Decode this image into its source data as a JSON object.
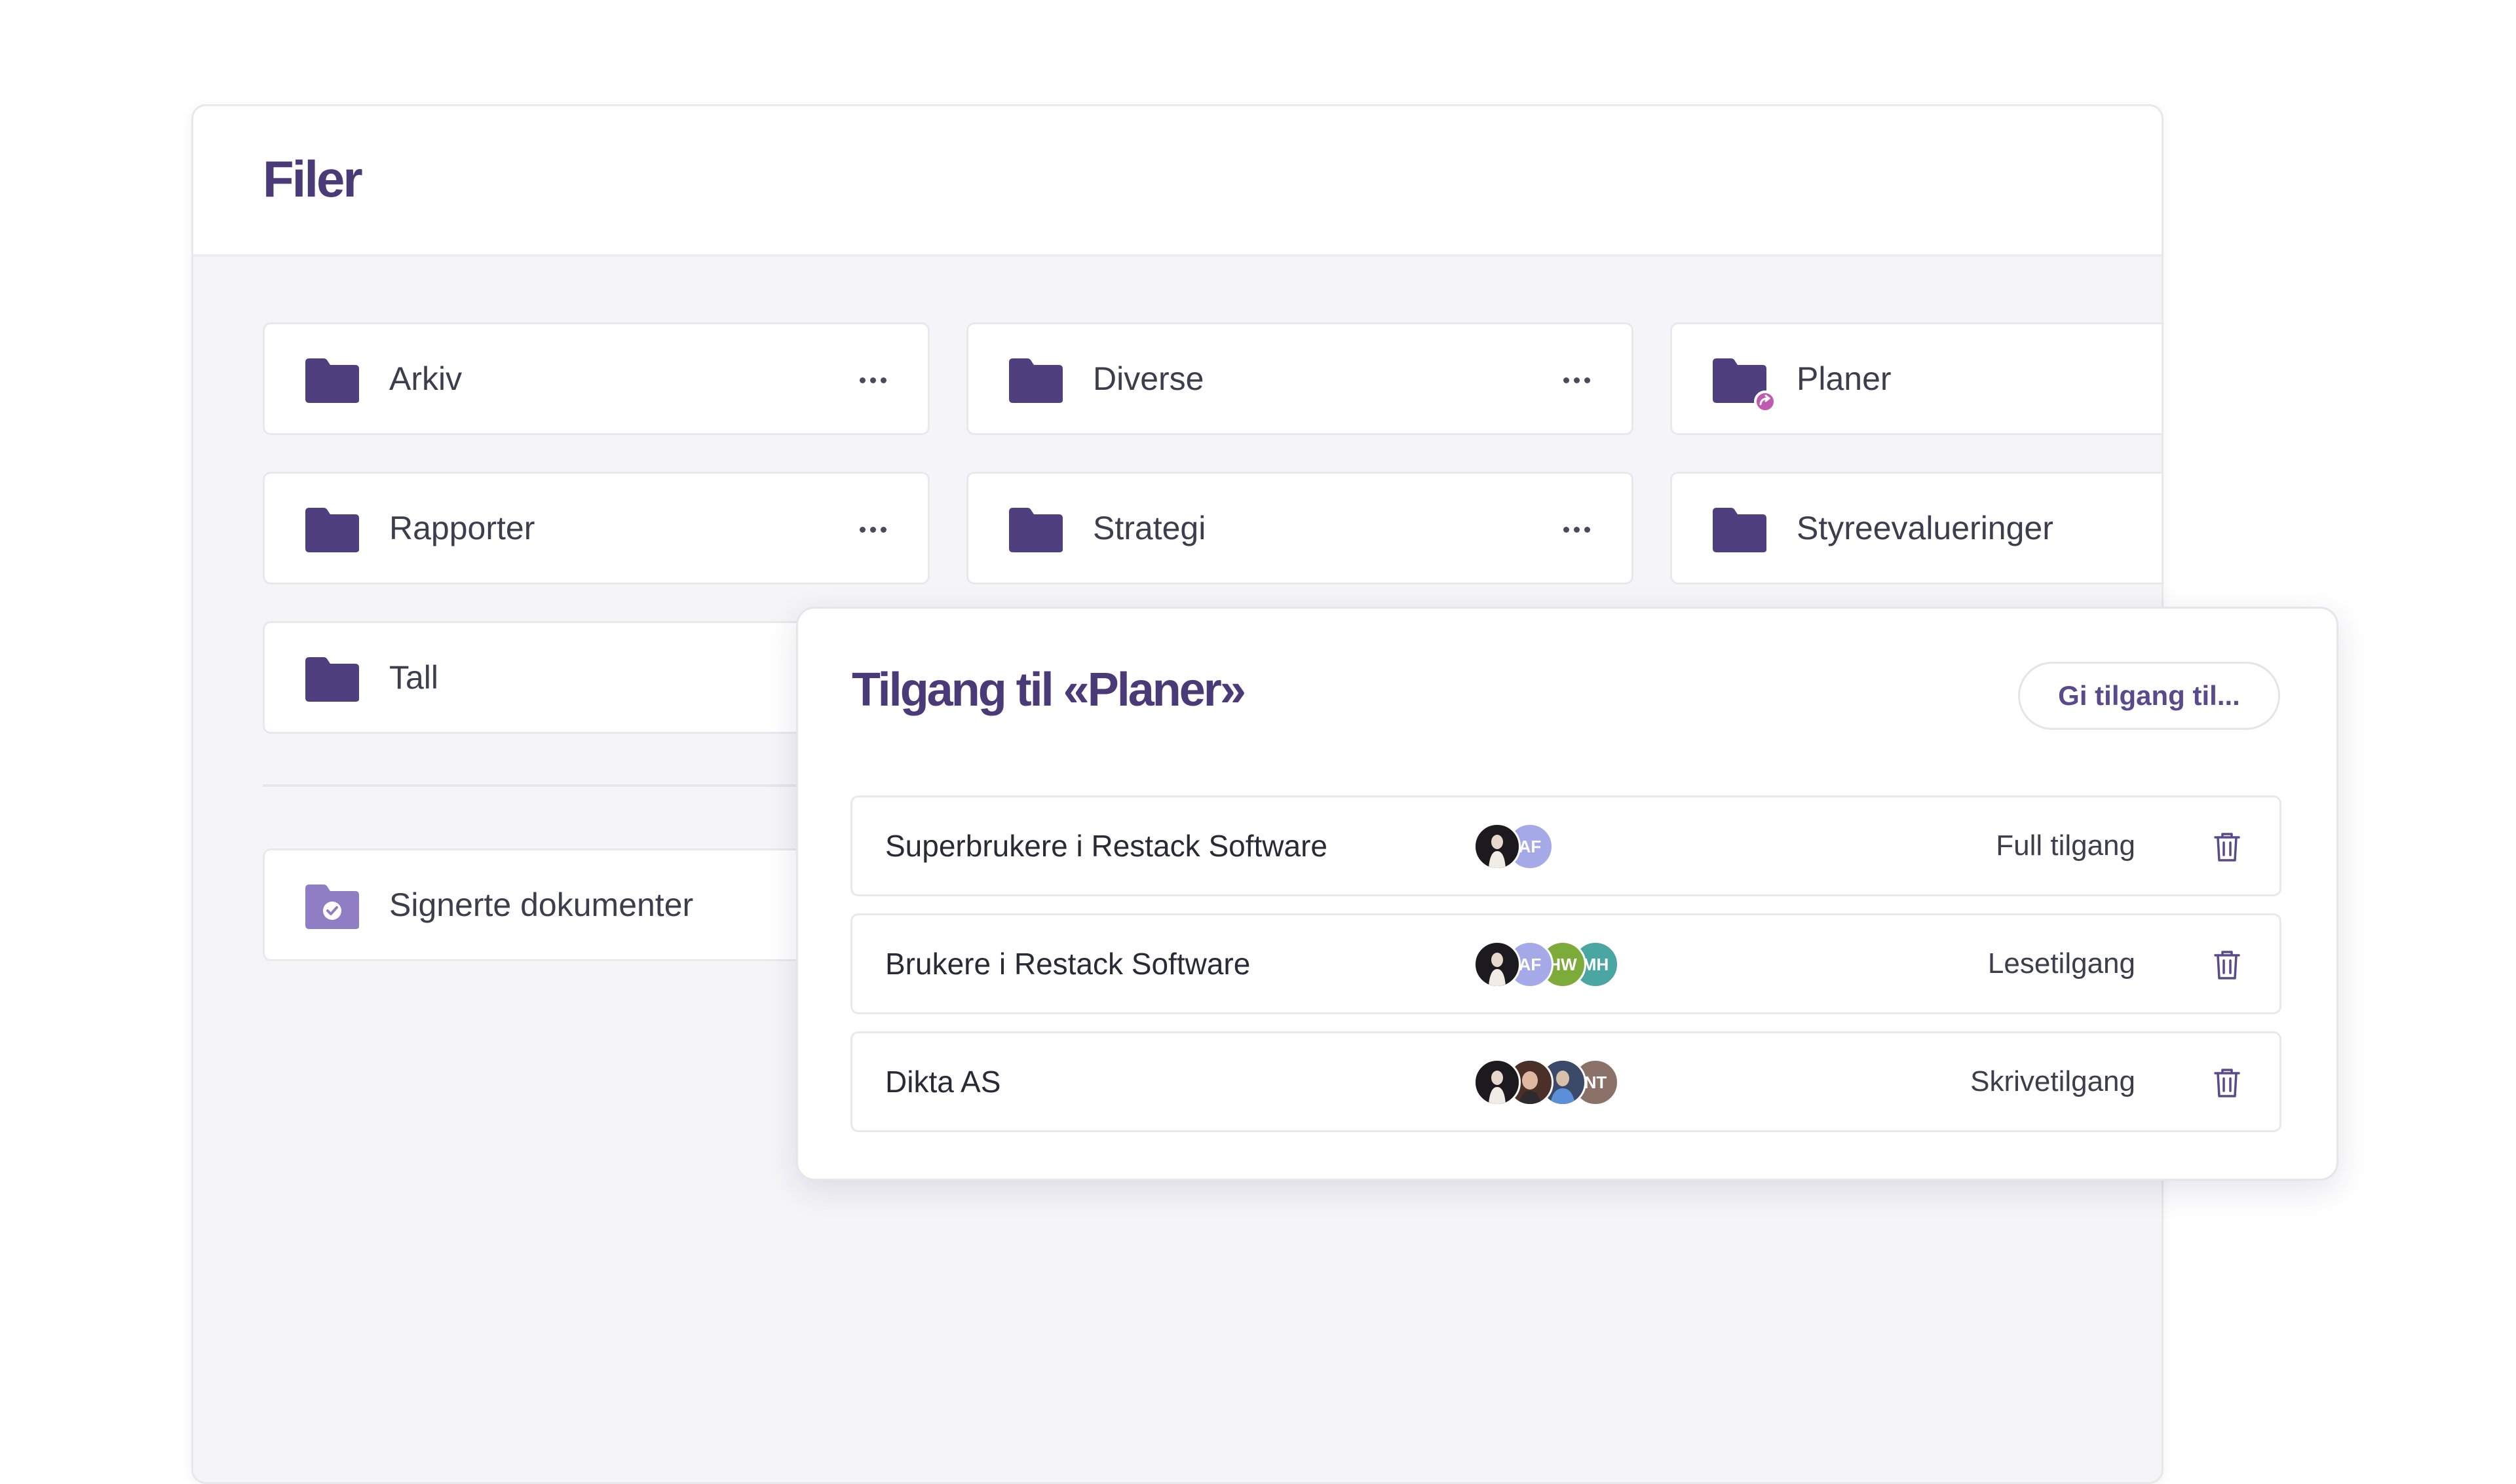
{
  "page_title": "Filer",
  "folders": [
    {
      "name": "Arkiv",
      "shared": false,
      "has_menu": true
    },
    {
      "name": "Diverse",
      "shared": false,
      "has_menu": true
    },
    {
      "name": "Planer",
      "shared": true,
      "has_menu": false
    },
    {
      "name": "Rapporter",
      "shared": false,
      "has_menu": true
    },
    {
      "name": "Strategi",
      "shared": false,
      "has_menu": true
    },
    {
      "name": "Styreevalueringer",
      "shared": false,
      "has_menu": false
    },
    {
      "name": "Tall",
      "shared": false,
      "has_menu": false
    }
  ],
  "signed_folder": {
    "name": "Signerte dokumenter"
  },
  "access_dialog": {
    "title": "Tilgang til «Planer»",
    "grant_button": "Gi tilgang til...",
    "rows": [
      {
        "group": "Superbrukere i Restack Software",
        "level": "Full tilgang",
        "avatars": [
          {
            "type": "photo",
            "color": "#1d1a1f"
          },
          {
            "type": "initials",
            "text": "AF",
            "color": "#a6a9e8"
          }
        ]
      },
      {
        "group": "Brukere i Restack Software",
        "level": "Lesetilgang",
        "avatars": [
          {
            "type": "photo",
            "color": "#1d1a1f"
          },
          {
            "type": "initials",
            "text": "AF",
            "color": "#a6a9e8"
          },
          {
            "type": "initials",
            "text": "HW",
            "color": "#7cab3a"
          },
          {
            "type": "initials",
            "text": "MH",
            "color": "#4aa6a2"
          }
        ]
      },
      {
        "group": "Dikta AS",
        "level": "Skrivetilgang",
        "avatars": [
          {
            "type": "photo",
            "color": "#1d1a1f"
          },
          {
            "type": "photo",
            "color": "#6b4a3e"
          },
          {
            "type": "photo",
            "color": "#3a4a68"
          },
          {
            "type": "initials",
            "text": "NT",
            "color": "#8a7268"
          }
        ]
      }
    ]
  },
  "colors": {
    "accent": "#4a3b78",
    "folder": "#4f3f7e",
    "signed_folder": "#8f7ec4",
    "shared_badge": "#c05ab0",
    "trash": "#5a4a8c"
  },
  "icons": {
    "folder": "folder-icon",
    "shared_folder": "shared-folder-icon",
    "signed_folder": "signed-folder-icon",
    "more": "more-horizontal-icon",
    "delete": "trash-icon"
  }
}
